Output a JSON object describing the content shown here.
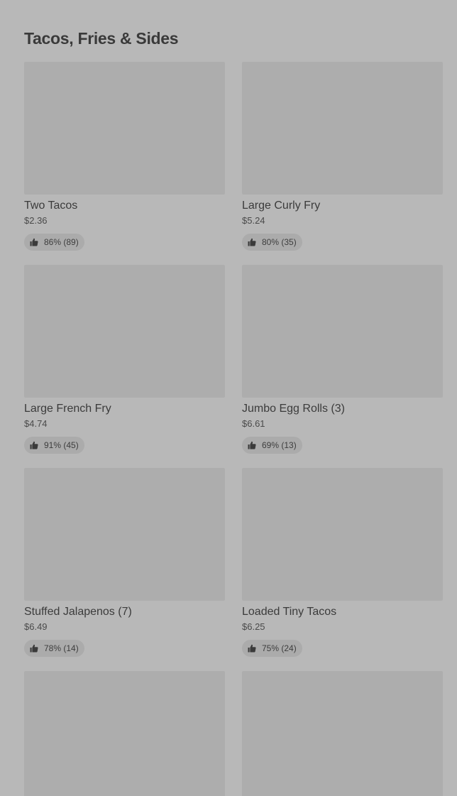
{
  "section": {
    "title": "Tacos, Fries & Sides"
  },
  "items": [
    {
      "name": "Two Tacos",
      "price": "$2.36",
      "rating": "86% (89)"
    },
    {
      "name": "Large Curly Fry",
      "price": "$5.24",
      "rating": "80% (35)"
    },
    {
      "name": "Large French Fry",
      "price": "$4.74",
      "rating": "91% (45)"
    },
    {
      "name": "Jumbo Egg Rolls (3)",
      "price": "$6.61",
      "rating": "69% (13)"
    },
    {
      "name": "Stuffed Jalapenos (7)",
      "price": "$6.49",
      "rating": "78% (14)"
    },
    {
      "name": "Loaded Tiny Tacos",
      "price": "$6.25",
      "rating": "75% (24)"
    },
    {
      "name": "",
      "price": "",
      "rating": ""
    },
    {
      "name": "",
      "price": "",
      "rating": ""
    }
  ],
  "icons": {
    "rating": "thumbs-up-icon"
  },
  "colors": {
    "background": "#b8b8b8",
    "image_placeholder": "#adadad",
    "rating_pill": "#ababab"
  }
}
